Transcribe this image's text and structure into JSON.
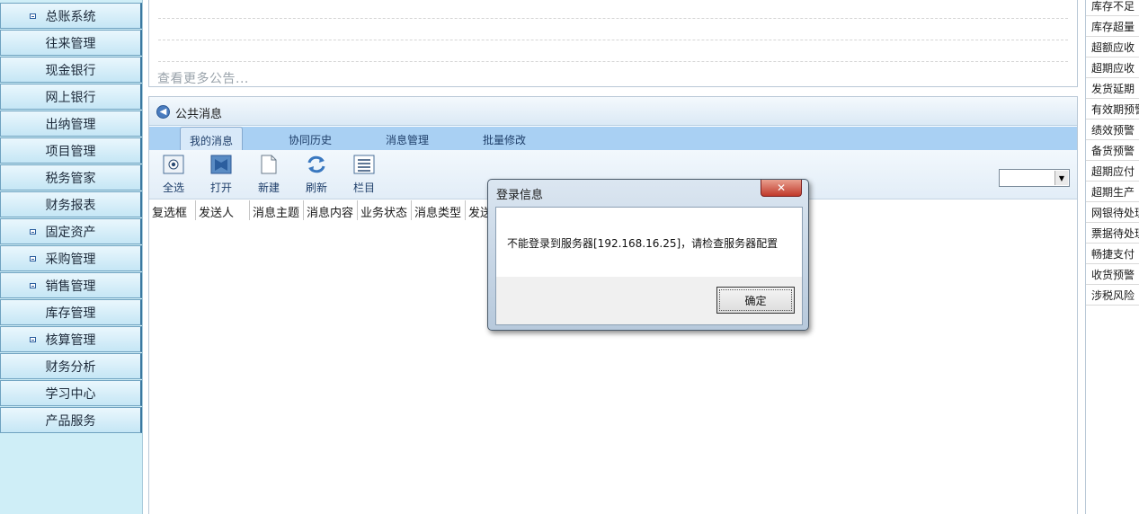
{
  "sidebar": {
    "items": [
      {
        "label": "总账系统",
        "expandable": true
      },
      {
        "label": "往来管理",
        "expandable": false
      },
      {
        "label": "现金银行",
        "expandable": false
      },
      {
        "label": "网上银行",
        "expandable": false
      },
      {
        "label": "出纳管理",
        "expandable": false
      },
      {
        "label": "项目管理",
        "expandable": false
      },
      {
        "label": "税务管家",
        "expandable": false
      },
      {
        "label": "财务报表",
        "expandable": false
      },
      {
        "label": "固定资产",
        "expandable": true
      },
      {
        "label": "采购管理",
        "expandable": true
      },
      {
        "label": "销售管理",
        "expandable": true
      },
      {
        "label": "库存管理",
        "expandable": false
      },
      {
        "label": "核算管理",
        "expandable": true
      },
      {
        "label": "财务分析",
        "expandable": false
      },
      {
        "label": "学习中心",
        "expandable": false
      },
      {
        "label": "产品服务",
        "expandable": false
      }
    ]
  },
  "notice": {
    "more_link": "查看更多公告..."
  },
  "panel": {
    "title": "公共消息",
    "tabs": [
      "我的消息",
      "协同历史",
      "消息管理",
      "批量修改"
    ],
    "toolbar": [
      "全选",
      "打开",
      "新建",
      "刷新",
      "栏目"
    ],
    "filter_value": "",
    "columns": [
      "复选框",
      "发送人",
      "消息主题",
      "消息内容",
      "业务状态",
      "消息类型",
      "发送"
    ]
  },
  "alerts": [
    "库存不足",
    "库存超量",
    "超额应收",
    "超期应收",
    "发货延期",
    "有效期预警",
    "绩效预警",
    "备货预警",
    "超期应付",
    "超期生产",
    "网银待处理",
    "票据待处理",
    "畅捷支付",
    "收货预警",
    "涉税风险"
  ],
  "dialog": {
    "title": "登录信息",
    "close_glyph": "✕",
    "message": "不能登录到服务器[192.168.16.25]，请检查服务器配置",
    "ok_label": "确定"
  },
  "colors": {
    "sidebar_bg": "#cfeef7",
    "tab_bar": "#a9d0f3",
    "close_red": "#c0392b"
  }
}
